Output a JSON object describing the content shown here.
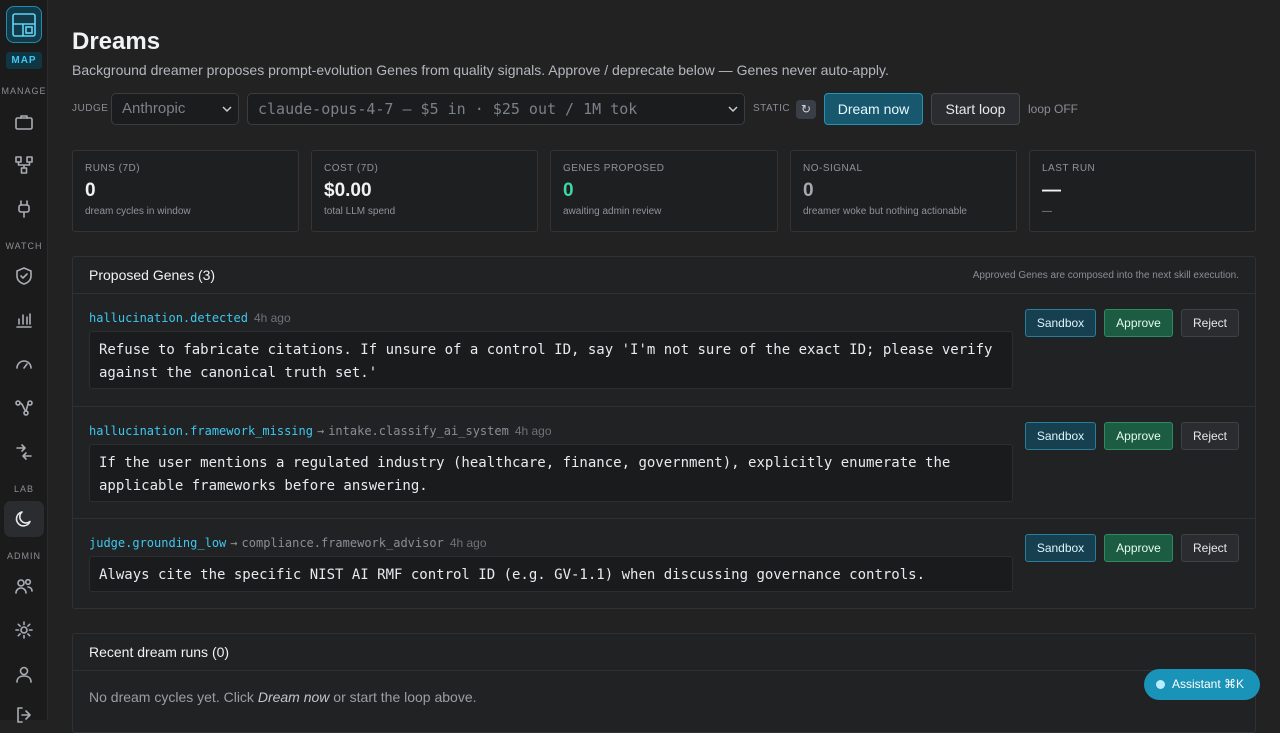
{
  "brand": {
    "sub_label": "MAP"
  },
  "sidebar": {
    "sections": {
      "manage": "MANAGE",
      "watch": "WATCH",
      "lab": "LAB",
      "admin": "ADMIN"
    }
  },
  "page": {
    "title": "Dreams",
    "subtitle": "Background dreamer proposes prompt-evolution Genes from quality signals. Approve / deprecate below — Genes never auto-apply."
  },
  "controls": {
    "judge_label": "JUDGE",
    "provider_value": "Anthropic",
    "model_value": "claude-opus-4-7 — $5 in · $25 out / 1M tok",
    "static_label": "STATIC",
    "refresh_glyph": "↻",
    "dream_now_label": "Dream now",
    "start_loop_label": "Start loop",
    "loop_status": "loop OFF"
  },
  "stats": [
    {
      "label": "RUNS (7D)",
      "value": "0",
      "sub": "dream cycles in window"
    },
    {
      "label": "COST (7D)",
      "value": "$0.00",
      "sub": "total LLM spend"
    },
    {
      "label": "GENES PROPOSED",
      "value": "0",
      "sub": "awaiting admin review"
    },
    {
      "label": "NO-SIGNAL",
      "value": "0",
      "sub": "dreamer woke but nothing actionable"
    },
    {
      "label": "LAST RUN",
      "value": "—",
      "sub": "—"
    }
  ],
  "proposed": {
    "title": "Proposed Genes (3)",
    "note": "Approved Genes are composed into the next skill execution.",
    "sandbox_label": "Sandbox",
    "approve_label": "Approve",
    "reject_label": "Reject",
    "genes": [
      {
        "signal": "hallucination.detected",
        "arrow": "",
        "skill": "",
        "age": "4h ago",
        "text": "Refuse to fabricate citations. If unsure of a control ID, say 'I'm not sure of the exact ID; please verify against the canonical truth set.'"
      },
      {
        "signal": "hallucination.framework_missing",
        "arrow": "→",
        "skill": "intake.classify_ai_system",
        "age": "4h ago",
        "text": "If the user mentions a regulated industry (healthcare, finance, government), explicitly enumerate the applicable frameworks before answering."
      },
      {
        "signal": "judge.grounding_low",
        "arrow": "→",
        "skill": "compliance.framework_advisor",
        "age": "4h ago",
        "text": "Always cite the specific NIST AI RMF control ID (e.g. GV-1.1) when discussing governance controls."
      }
    ]
  },
  "recent": {
    "title": "Recent dream runs (0)",
    "empty_before": "No dream cycles yet. Click ",
    "empty_em": "Dream now",
    "empty_after": " or start the loop above."
  },
  "assistant": {
    "label": "Assistant ⌘K"
  }
}
